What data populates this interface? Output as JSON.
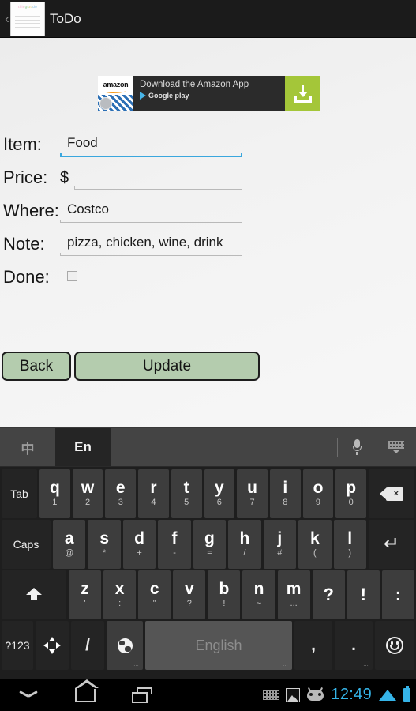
{
  "actionbar": {
    "back_icon": "chevron-left-icon",
    "app_icon": "todo-notepad-icon",
    "app_icon_title_parts": [
      "thin",
      "gs",
      "to",
      "do"
    ],
    "title": "ToDo"
  },
  "ad": {
    "logo_word": "amazon",
    "headline": "Download the Amazon App",
    "store": "Google play",
    "cta_icon": "download-icon",
    "cta_color": "#a4c639"
  },
  "form": {
    "fields": [
      {
        "label": "Item:",
        "value": "Food",
        "focused": true,
        "prefix": ""
      },
      {
        "label": "Price:",
        "value": "",
        "focused": false,
        "prefix": "$"
      },
      {
        "label": "Where:",
        "value": "Costco",
        "focused": false,
        "prefix": ""
      },
      {
        "label": "Note:",
        "value": "pizza, chicken, wine, drink",
        "focused": false,
        "prefix": ""
      }
    ],
    "done_label": "Done:",
    "done_checked": false,
    "focus_color": "#3aa7de",
    "underline_color": "#b9b9b9"
  },
  "buttons": {
    "back": "Back",
    "update": "Update",
    "color": "#b4ccae"
  },
  "keyboard": {
    "toolbar": {
      "tab_chinese": "中",
      "tab_english": "En",
      "active_tab": "En",
      "mic_icon": "microphone-icon",
      "hide_icon": "hide-keyboard-icon"
    },
    "row1": {
      "tab": "Tab",
      "keys": [
        {
          "main": "q",
          "sub": "1"
        },
        {
          "main": "w",
          "sub": "2"
        },
        {
          "main": "e",
          "sub": "3"
        },
        {
          "main": "r",
          "sub": "4"
        },
        {
          "main": "t",
          "sub": "5"
        },
        {
          "main": "y",
          "sub": "6"
        },
        {
          "main": "u",
          "sub": "7"
        },
        {
          "main": "i",
          "sub": "8"
        },
        {
          "main": "o",
          "sub": "9"
        },
        {
          "main": "p",
          "sub": "0"
        }
      ],
      "backspace_icon": "backspace-icon"
    },
    "row2": {
      "caps": "Caps",
      "keys": [
        {
          "main": "a",
          "sub": "@"
        },
        {
          "main": "s",
          "sub": "*"
        },
        {
          "main": "d",
          "sub": "+"
        },
        {
          "main": "f",
          "sub": "-"
        },
        {
          "main": "g",
          "sub": "="
        },
        {
          "main": "h",
          "sub": "/"
        },
        {
          "main": "j",
          "sub": "#"
        },
        {
          "main": "k",
          "sub": "("
        },
        {
          "main": "l",
          "sub": ")"
        }
      ],
      "enter_icon": "enter-icon"
    },
    "row3": {
      "shift_icon": "shift-icon",
      "keys": [
        {
          "main": "z",
          "sub": "'"
        },
        {
          "main": "x",
          "sub": ":"
        },
        {
          "main": "c",
          "sub": "\""
        },
        {
          "main": "v",
          "sub": "?"
        },
        {
          "main": "b",
          "sub": "!"
        },
        {
          "main": "n",
          "sub": "~"
        },
        {
          "main": "m",
          "sub": "..."
        }
      ],
      "punct": [
        "?",
        "!",
        ":"
      ]
    },
    "row4": {
      "symbols": "?123",
      "dpad_icon": "dpad-arrows-icon",
      "slash": "/",
      "globe_icon": "globe-language-icon",
      "space_label": "English",
      "comma": ",",
      "period": ".",
      "emoji_icon": "emoji-smiley-icon"
    }
  },
  "navbar": {
    "back_icon": "collapse-keyboard-icon",
    "home_icon": "home-icon",
    "recents_icon": "recents-icon",
    "status": {
      "keyboard_icon": "keyboard-status-icon",
      "image_icon": "screenshot-icon",
      "cyanogen_icon": "cyanogenmod-icon",
      "time": "12:49",
      "wifi_icon": "wifi-icon",
      "battery_icon": "battery-full-icon",
      "accent_color": "#35b4e8"
    }
  }
}
